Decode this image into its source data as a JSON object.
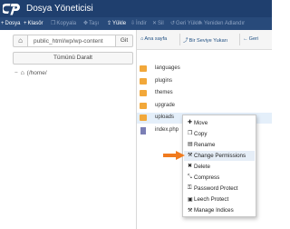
{
  "app": {
    "title": "Dosya Yöneticisi"
  },
  "colors": {
    "titlebar": "#1f3f6e",
    "toolbar": "#284a7a",
    "folder": "#f2a83a",
    "accent_arrow": "#f07b1f",
    "selection": "#e4effa"
  },
  "toolbar": [
    {
      "label": "Dosya",
      "icon": "plus-icon",
      "glyph": "+",
      "enabled": true
    },
    {
      "label": "Klasör",
      "icon": "plus-icon",
      "glyph": "+",
      "enabled": true
    },
    {
      "label": "Kopyala",
      "icon": "copy-icon",
      "glyph": "❐",
      "enabled": false
    },
    {
      "label": "Taşı",
      "icon": "move-icon",
      "glyph": "✥",
      "enabled": false
    },
    {
      "label": "Yükle",
      "icon": "upload-icon",
      "glyph": "⇪",
      "enabled": true
    },
    {
      "label": "İndir",
      "icon": "download-icon",
      "glyph": "⇩",
      "enabled": false
    },
    {
      "label": "Sil",
      "icon": "delete-icon",
      "glyph": "✕",
      "enabled": false
    },
    {
      "label": "Geri Yükle",
      "icon": "restore-icon",
      "glyph": "↺",
      "enabled": false
    },
    {
      "label": "Yeniden Adlandır",
      "icon": "rename-icon",
      "glyph": "✎",
      "enabled": false
    }
  ],
  "left_panel": {
    "path_value": "public_html/wp/wp-content",
    "go_label": "Git",
    "collapse_label": "Tümünü Daralt",
    "tree_root": "(/home/"
  },
  "nav": [
    {
      "label": "Ana sayfa",
      "glyph": "⌂"
    },
    {
      "label": "Bir Seviye Yukarı",
      "glyph": "⤴"
    },
    {
      "label": "Geri",
      "glyph": "←"
    }
  ],
  "files": [
    {
      "name": "languages",
      "type": "folder",
      "selected": false
    },
    {
      "name": "plugins",
      "type": "folder",
      "selected": false
    },
    {
      "name": "themes",
      "type": "folder",
      "selected": false
    },
    {
      "name": "upgrade",
      "type": "folder",
      "selected": false
    },
    {
      "name": "uploads",
      "type": "folder",
      "selected": true
    },
    {
      "name": "index.php",
      "type": "php",
      "selected": false
    }
  ],
  "context_menu": [
    {
      "label": "Move",
      "icon": "move-icon",
      "glyph": "✚",
      "hover": false
    },
    {
      "label": "Copy",
      "icon": "copy-icon",
      "glyph": "❐",
      "hover": false
    },
    {
      "label": "Rename",
      "icon": "rename-icon",
      "glyph": "▤",
      "hover": false
    },
    {
      "label": "Change Permissions",
      "icon": "wrench-icon",
      "glyph": "⚒",
      "hover": true
    },
    {
      "label": "Delete",
      "icon": "delete-icon",
      "glyph": "✖",
      "hover": false
    },
    {
      "label": "Compress",
      "icon": "compress-icon",
      "glyph": "⤡",
      "hover": false
    },
    {
      "label": "Password Protect",
      "icon": "key-icon",
      "glyph": "⚿",
      "hover": false
    },
    {
      "label": "Leech Protect",
      "icon": "lock-icon",
      "glyph": "▣",
      "hover": false
    },
    {
      "label": "Manage Indices",
      "icon": "wrench-icon",
      "glyph": "⚒",
      "hover": false
    }
  ]
}
